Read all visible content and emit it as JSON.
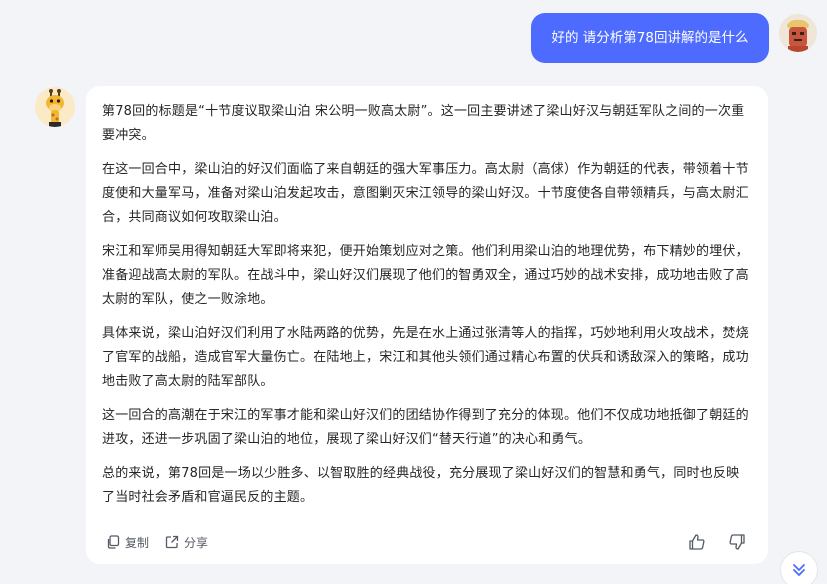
{
  "user_message": {
    "text": "好的 请分析第78回讲解的是什么"
  },
  "assistant_message": {
    "paragraphs": [
      "第78回的标题是“十节度议取梁山泊 宋公明一败高太尉”。这一回主要讲述了梁山好汉与朝廷军队之间的一次重要冲突。",
      "在这一回合中，梁山泊的好汉们面临了来自朝廷的强大军事压力。高太尉（高俅）作为朝廷的代表，带领着十节度使和大量军马，准备对梁山泊发起攻击，意图剿灭宋江领导的梁山好汉。十节度使各自带领精兵，与高太尉汇合，共同商议如何攻取梁山泊。",
      "宋江和军师吴用得知朝廷大军即将来犯，便开始策划应对之策。他们利用梁山泊的地理优势，布下精妙的埋伏，准备迎战高太尉的军队。在战斗中，梁山好汉们展现了他们的智勇双全，通过巧妙的战术安排，成功地击败了高太尉的军队，使之一败涂地。",
      "具体来说，梁山泊好汉们利用了水陆两路的优势，先是在水上通过张清等人的指挥，巧妙地利用火攻战术，焚烧了官军的战船，造成官军大量伤亡。在陆地上，宋江和其他头领们通过精心布置的伏兵和诱敌深入的策略，成功地击败了高太尉的陆军部队。",
      "这一回合的高潮在于宋江的军事才能和梁山好汉们的团结协作得到了充分的体现。他们不仅成功地抵御了朝廷的进攻，还进一步巩固了梁山泊的地位，展现了梁山好汉们“替天行道”的决心和勇气。",
      "总的来说，第78回是一场以少胜多、以智取胜的经典战役，充分展现了梁山好汉们的智慧和勇气，同时也反映了当时社会矛盾和官逼民反的主题。"
    ]
  },
  "actions": {
    "copy_label": "复制",
    "share_label": "分享",
    "copy_icon": "copy-icon",
    "share_icon": "share-icon",
    "like_icon": "thumbs-up-icon",
    "dislike_icon": "thumbs-down-icon",
    "scroll_icon": "double-chevron-down-icon"
  },
  "colors": {
    "accent": "#4d6bfe",
    "background": "#f3f4f7",
    "card": "#ffffff",
    "text": "#262626"
  }
}
